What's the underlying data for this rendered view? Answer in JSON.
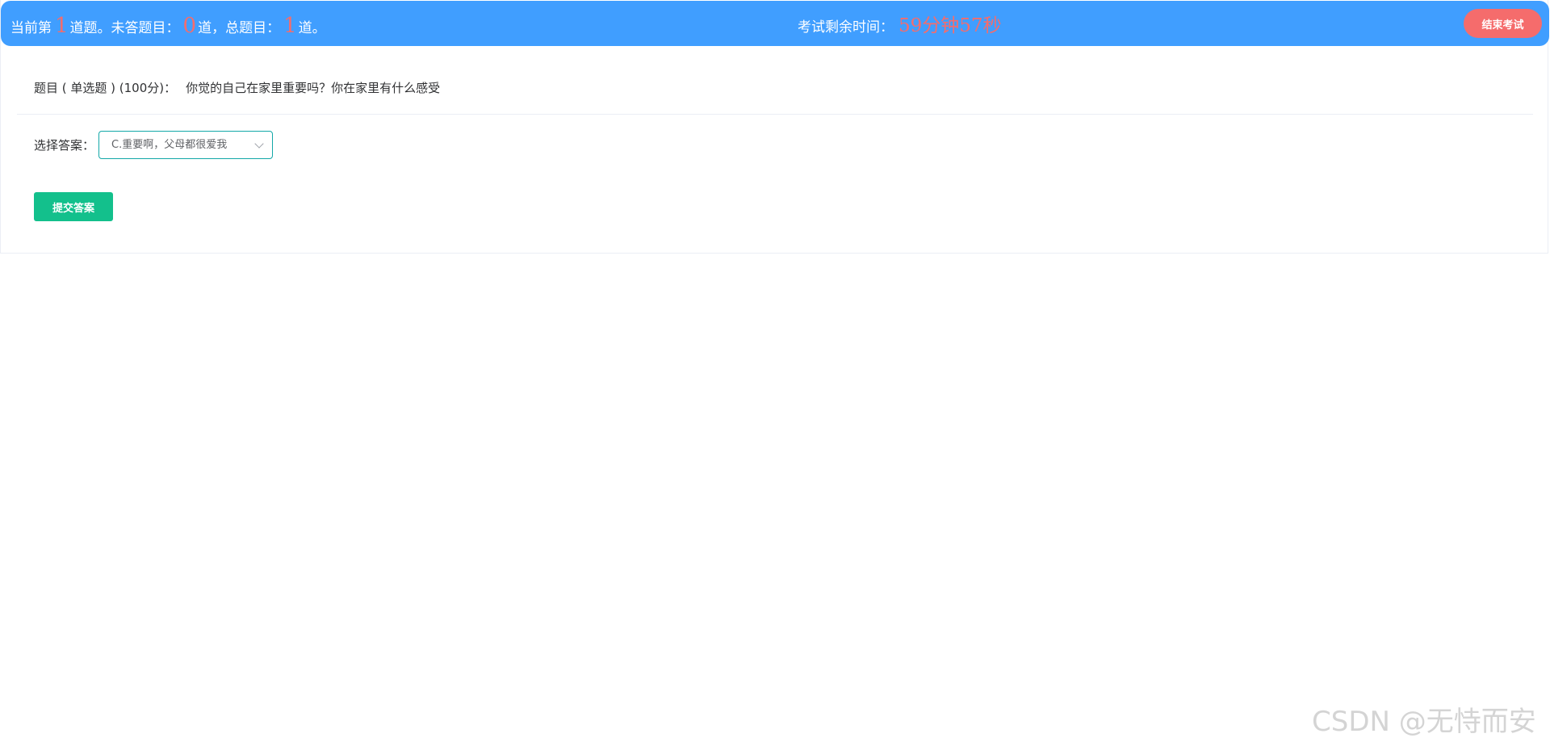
{
  "header": {
    "progress_prefix": "当前第",
    "current_index": "1",
    "progress_mid1": "道题。未答题目：",
    "unanswered": "0",
    "progress_mid2": "道，总题目：",
    "total": "1",
    "progress_suffix": "道。",
    "timer_label": "考试剩余时间：",
    "timer_value": "59分钟57秒",
    "end_button": "结束考试"
  },
  "question": {
    "meta": "题目 ( 单选题 ) (100分)：",
    "text": "你觉的自己在家里重要吗？你在家里有什么感受"
  },
  "answer": {
    "label": "选择答案：",
    "selected": "C.重要啊，父母都很爱我",
    "dropdown_icon": "chevron-down-icon"
  },
  "submit_button": "提交答案",
  "watermark": "CSDN @无恃而安",
  "colors": {
    "header_bg": "#409eff",
    "accent_red": "#f56c6c",
    "submit_green": "#13c08c",
    "select_border": "#13a8a8"
  }
}
